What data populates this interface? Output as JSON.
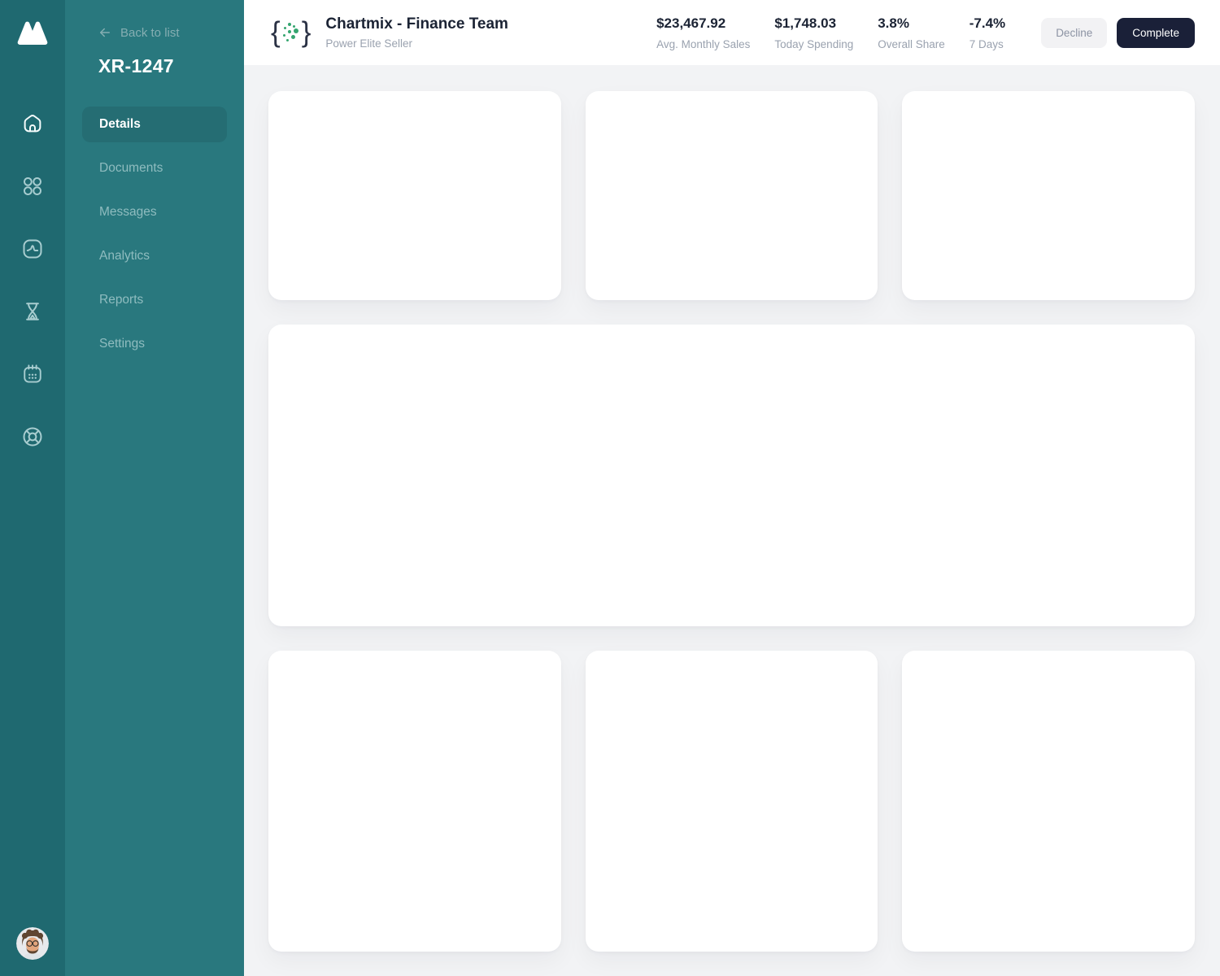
{
  "rail": {
    "icons": [
      "home-icon",
      "grid-icon",
      "activity-icon",
      "hourglass-icon",
      "calendar-icon",
      "lifebuoy-icon"
    ]
  },
  "sidebar": {
    "back_label": "Back to list",
    "case_id": "XR-1247",
    "items": [
      {
        "label": "Details",
        "active": true
      },
      {
        "label": "Documents",
        "active": false
      },
      {
        "label": "Messages",
        "active": false
      },
      {
        "label": "Analytics",
        "active": false
      },
      {
        "label": "Reports",
        "active": false
      },
      {
        "label": "Settings",
        "active": false
      }
    ]
  },
  "header": {
    "logo": {
      "left_brace": "{",
      "right_brace": "}"
    },
    "title": "Chartmix - Finance Team",
    "subtitle": "Power Elite Seller",
    "stats": [
      {
        "value": "$23,467.92",
        "label": "Avg. Monthly Sales"
      },
      {
        "value": "$1,748.03",
        "label": "Today Spending"
      },
      {
        "value": "3.8%",
        "label": "Overall Share"
      },
      {
        "value": "-7.4%",
        "label": "7 Days"
      }
    ],
    "buttons": {
      "decline": "Decline",
      "complete": "Complete"
    }
  },
  "colors": {
    "rail_bg": "#1f6970",
    "panel_bg": "#29787e",
    "active_item_bg": "#256d73",
    "logo_green": "#34a56f",
    "dark_navy": "#1a2038",
    "content_bg": "#f2f3f5",
    "card_bg": "#ffffff"
  }
}
